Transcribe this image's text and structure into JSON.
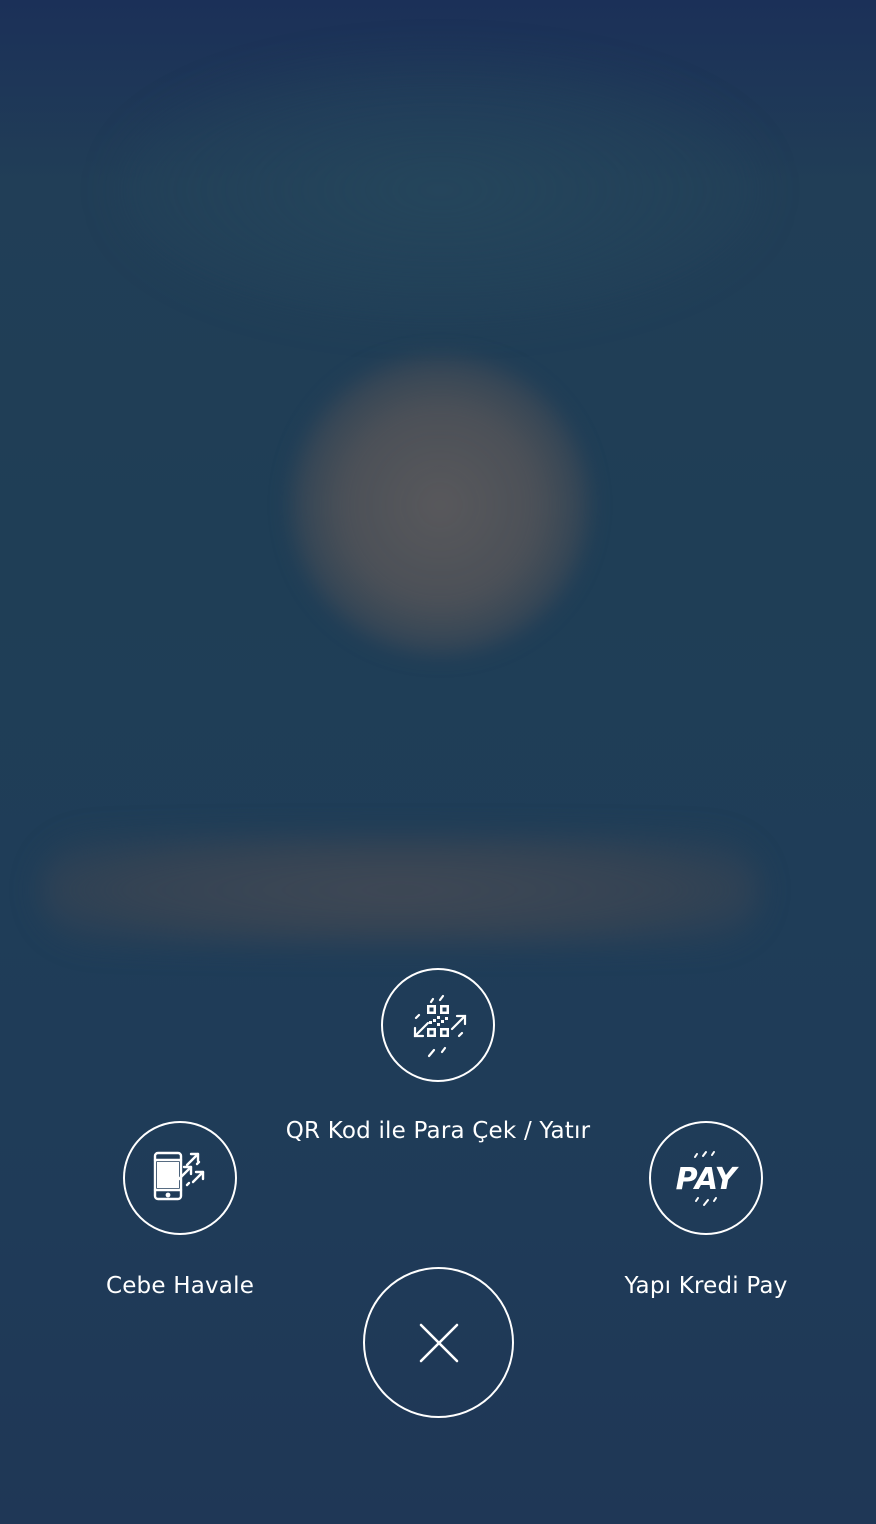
{
  "actions": {
    "qr": {
      "label": "QR Kod ile Para Çek / Yatır",
      "icon": "qr-transfer-icon"
    },
    "cebe_havale": {
      "label": "Cebe Havale",
      "icon": "phone-transfer-icon"
    },
    "yapi_kredi_pay": {
      "label": "Yapı Kredi Pay",
      "icon": "pay-icon",
      "icon_text": "PAY"
    }
  },
  "close": {
    "icon": "close-icon"
  },
  "colors": {
    "background": "#1f3d58",
    "foreground": "#ffffff"
  }
}
